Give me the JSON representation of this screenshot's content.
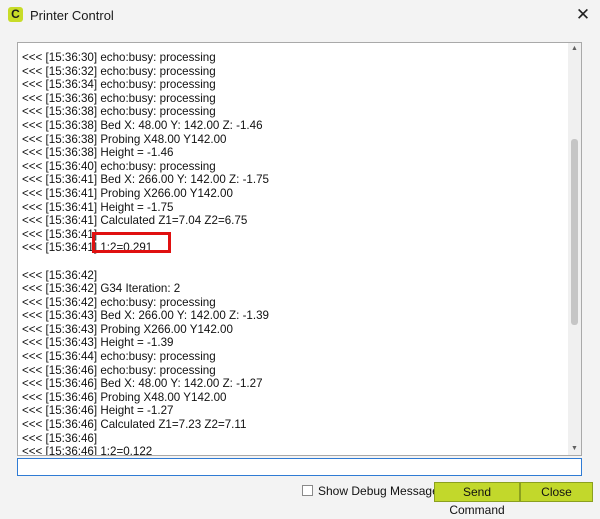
{
  "window": {
    "title": "Printer Control",
    "icon_letter": "C",
    "close_glyph": "✕"
  },
  "console": {
    "lines": [
      "<<< [15:36:30] echo:busy: processing",
      "<<< [15:36:32] echo:busy: processing",
      "<<< [15:36:34] echo:busy: processing",
      "<<< [15:36:36] echo:busy: processing",
      "<<< [15:36:38] echo:busy: processing",
      "<<< [15:36:38] Bed X: 48.00 Y: 142.00 Z: -1.46",
      "<<< [15:36:38] Probing X48.00 Y142.00",
      "<<< [15:36:38] Height = -1.46",
      "<<< [15:36:40] echo:busy: processing",
      "<<< [15:36:41] Bed X: 266.00 Y: 142.00 Z: -1.75",
      "<<< [15:36:41] Probing X266.00 Y142.00",
      "<<< [15:36:41] Height = -1.75",
      "<<< [15:36:41] Calculated Z1=7.04 Z2=6.75",
      "<<< [15:36:41]",
      "<<< [15:36:41] 1:2=0.291",
      "",
      "<<< [15:36:42]",
      "<<< [15:36:42] G34 Iteration: 2",
      "<<< [15:36:42] echo:busy: processing",
      "<<< [15:36:43] Bed X: 266.00 Y: 142.00 Z: -1.39",
      "<<< [15:36:43] Probing X266.00 Y142.00",
      "<<< [15:36:43] Height = -1.39",
      "<<< [15:36:44] echo:busy: processing",
      "<<< [15:36:46] echo:busy: processing",
      "<<< [15:36:46] Bed X: 48.00 Y: 142.00 Z: -1.27",
      "<<< [15:36:46] Probing X48.00 Y142.00",
      "<<< [15:36:46] Height = -1.27",
      "<<< [15:36:46] Calculated Z1=7.23 Z2=7.11",
      "<<< [15:36:46]",
      "<<< [15:36:46] 1:2=0.122"
    ],
    "scroll_up_glyph": "▲",
    "scroll_down_glyph": "▼"
  },
  "input": {
    "value": ""
  },
  "footer": {
    "debug_label": "Show Debug Messages",
    "debug_checked": false,
    "send_label": "Send Command",
    "close_label": "Close"
  },
  "colors": {
    "accent": "#c2d82b",
    "highlight": "#e01010",
    "input_focus": "#2f7bd4"
  }
}
